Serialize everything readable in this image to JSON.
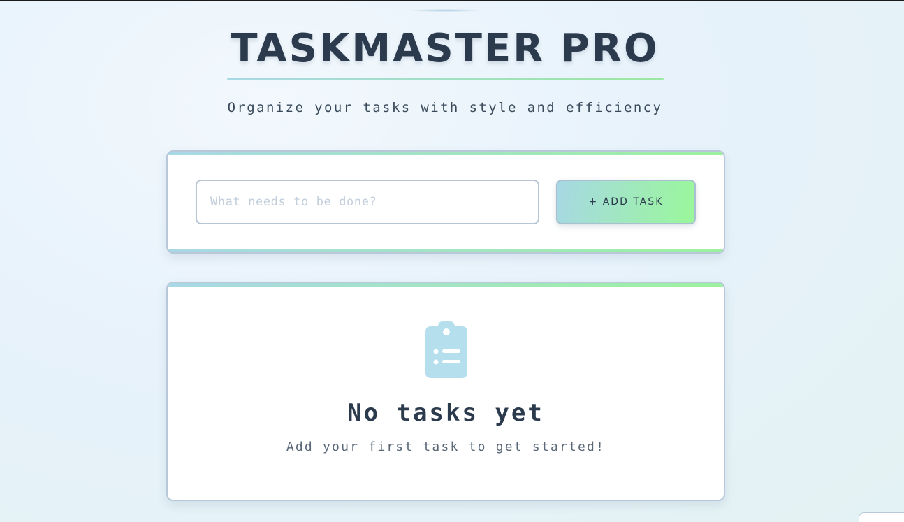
{
  "header": {
    "title": "TASKMASTER PRO",
    "subtitle": "Organize your tasks with style and efficiency"
  },
  "input_card": {
    "placeholder": "What needs to be done?",
    "value": "",
    "add_button_label": "+ ADD TASK"
  },
  "task_list": {
    "tasks": [],
    "empty_icon": "clipboard-list-icon",
    "empty_title": "No tasks yet",
    "empty_subtitle": "Add your first task to get started!"
  },
  "colors": {
    "accent_start": "#a8d8e6",
    "accent_end": "#9cf19f",
    "text_dark": "#2b3a4d",
    "icon": "#b6dfed"
  }
}
